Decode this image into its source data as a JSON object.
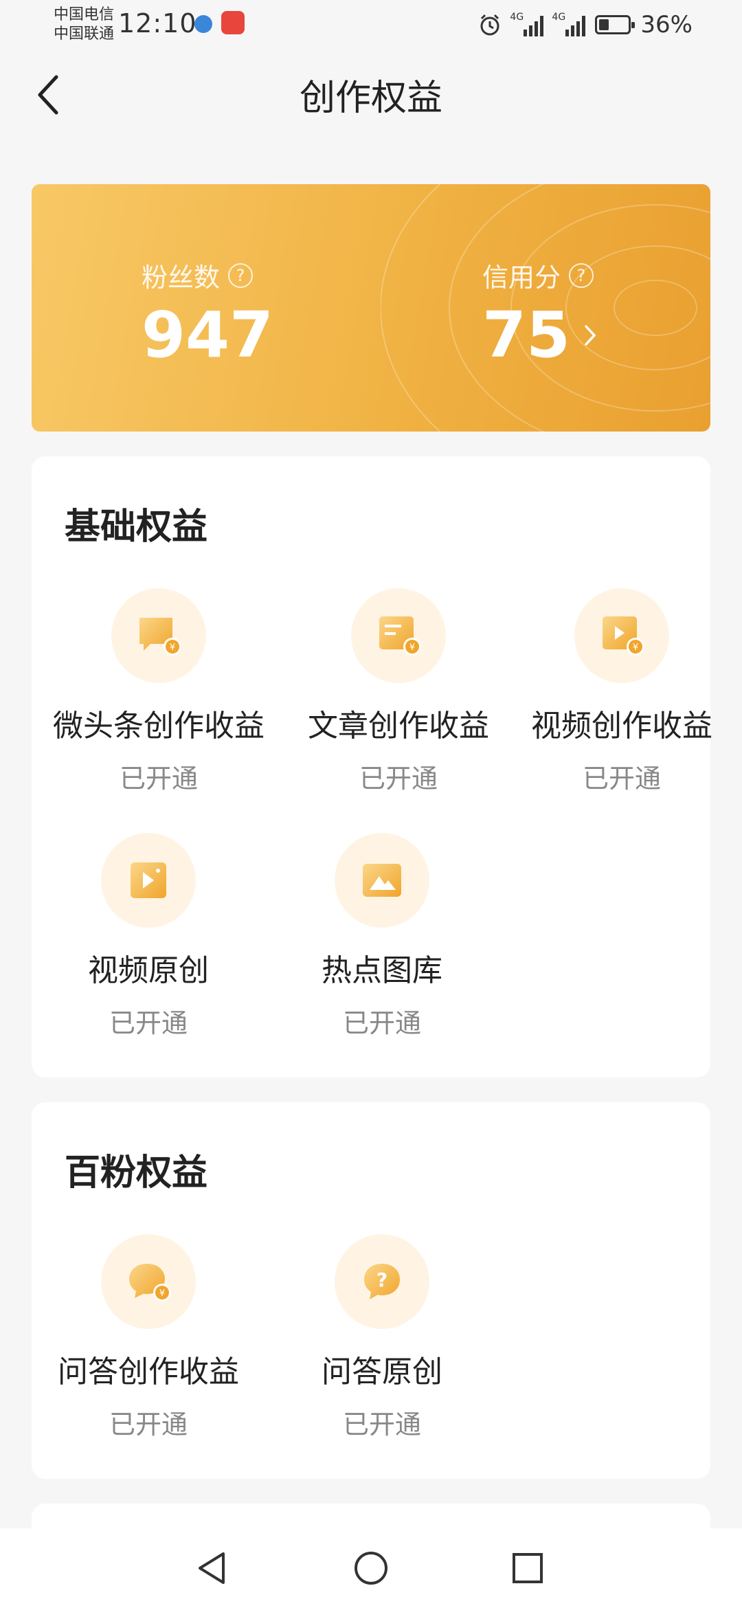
{
  "status_bar": {
    "carrier_1": "中国电信",
    "carrier_2": "中国联通",
    "time": "12:10",
    "network_1": "4G",
    "network_2": "4G",
    "battery_percent": "36%",
    "battery_level": 0.36,
    "icons": [
      "network-app-icon",
      "huawei-app-icon",
      "alarm-icon",
      "signal-icon",
      "signal-icon",
      "battery-icon"
    ]
  },
  "header": {
    "title": "创作权益",
    "back_icon": "back-arrow-icon"
  },
  "stats": {
    "fans_label": "粉丝数",
    "fans_value": "947",
    "credit_label": "信用分",
    "credit_value": "75",
    "help_icon": "question-circle-icon",
    "chevron_icon": "chevron-right-icon",
    "gradient_colors": [
      "#f8c866",
      "#e9a030"
    ]
  },
  "basic": {
    "title": "基础权益",
    "items": [
      {
        "name": "微头条创作收益",
        "status": "已开通",
        "icon": "micro-post-income-icon"
      },
      {
        "name": "文章创作收益",
        "status": "已开通",
        "icon": "article-income-icon"
      },
      {
        "name": "视频创作收益",
        "status": "已开通",
        "icon": "video-income-icon"
      },
      {
        "name": "视频原创",
        "status": "已开通",
        "icon": "video-original-icon"
      },
      {
        "name": "热点图库",
        "status": "已开通",
        "icon": "image-library-icon"
      }
    ]
  },
  "hundred": {
    "title": "百粉权益",
    "items": [
      {
        "name": "问答创作收益",
        "status": "已开通",
        "icon": "qa-income-icon"
      },
      {
        "name": "问答原创",
        "status": "已开通",
        "icon": "qa-original-icon"
      }
    ]
  },
  "nav": {
    "icons": [
      "nav-back-icon",
      "nav-home-icon",
      "nav-recents-icon"
    ]
  },
  "colors": {
    "accent": "#f0b243",
    "icon_gradient": [
      "#fbd68a",
      "#f0a52b"
    ],
    "icon_bg": "#fff4e3"
  }
}
